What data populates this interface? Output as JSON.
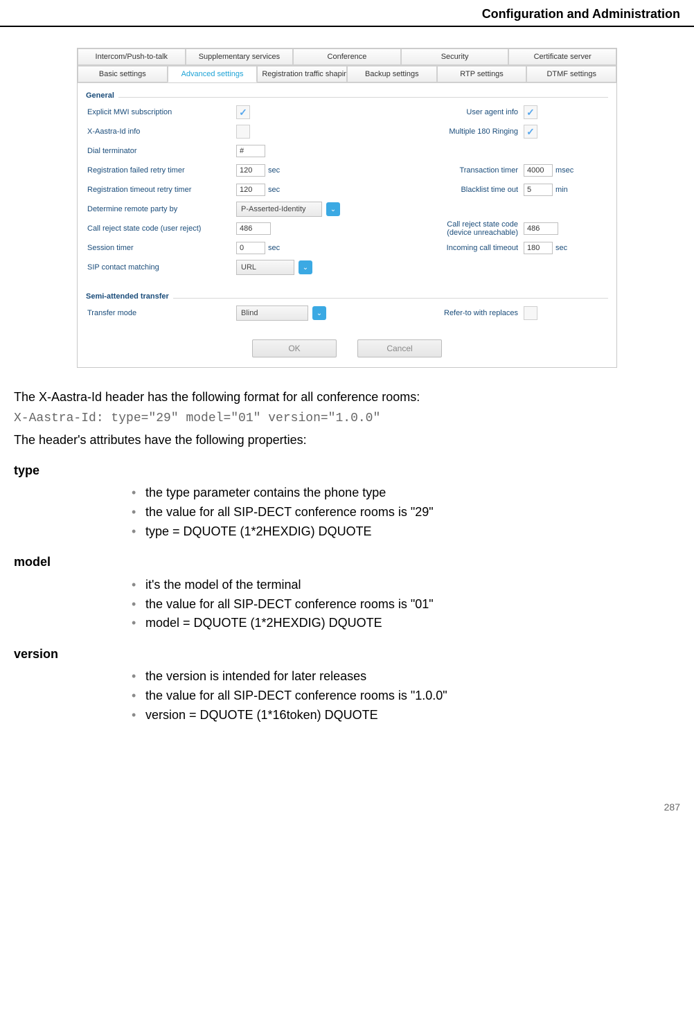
{
  "header": {
    "title": "Configuration and Administration"
  },
  "tabs_row1": [
    {
      "label": "Intercom/Push-to-talk"
    },
    {
      "label": "Supplementary services"
    },
    {
      "label": "Conference"
    },
    {
      "label": "Security"
    },
    {
      "label": "Certificate server"
    }
  ],
  "tabs_row2": [
    {
      "label": "Basic settings"
    },
    {
      "label": "Advanced settings",
      "active": true
    },
    {
      "label": "Registration traffic shaping"
    },
    {
      "label": "Backup settings"
    },
    {
      "label": "RTP settings"
    },
    {
      "label": "DTMF settings"
    }
  ],
  "section_general": "General",
  "section_transfer": "Semi-attended transfer",
  "labels": {
    "explicit_mwi": "Explicit MWI subscription",
    "user_agent": "User agent info",
    "x_aastra": "X-Aastra-Id info",
    "multi_180": "Multiple 180 Ringing",
    "dial_term": "Dial terminator",
    "reg_failed": "Registration failed retry timer",
    "trans_timer": "Transaction timer",
    "reg_timeout": "Registration timeout retry timer",
    "blacklist": "Blacklist time out",
    "determine": "Determine remote party by",
    "call_reject_user": "Call reject state code (user reject)",
    "call_reject_dev1": "Call reject state code",
    "call_reject_dev2": "(device unreachable)",
    "session_timer": "Session timer",
    "incoming_timeout": "Incoming call timeout",
    "sip_contact": "SIP contact matching",
    "transfer_mode": "Transfer mode",
    "refer_to": "Refer-to with replaces"
  },
  "values": {
    "dial_term": "#",
    "reg_failed": "120",
    "reg_timeout": "120",
    "trans_timer": "4000",
    "blacklist": "5",
    "determine": "P-Asserted-Identity",
    "reject_user": "486",
    "reject_dev": "486",
    "session_timer": "0",
    "incoming_timeout": "180",
    "sip_contact": "URL",
    "transfer_mode": "Blind"
  },
  "units": {
    "sec": "sec",
    "msec": "msec",
    "min": "min"
  },
  "buttons": {
    "ok": "OK",
    "cancel": "Cancel"
  },
  "check": "✓",
  "doc": {
    "p1": "The X-Aastra-Id header has the following format for all conference rooms:",
    "code": "X-Aastra-Id: type=\"29\" model=\"01\" version=\"1.0.0\"",
    "p2": "The header's attributes have the following properties:",
    "type_head": "type",
    "type_items": [
      "the type parameter contains the phone type",
      "the value for all SIP-DECT conference rooms is \"29\"",
      "type = DQUOTE (1*2HEXDIG) DQUOTE"
    ],
    "model_head": "model",
    "model_items": [
      "it's the model of the terminal",
      "the value for all SIP-DECT conference rooms is \"01\"",
      "model = DQUOTE (1*2HEXDIG) DQUOTE"
    ],
    "version_head": "version",
    "version_items": [
      "the version is intended for later releases",
      "the value for all SIP-DECT conference rooms is \"1.0.0\"",
      "version = DQUOTE (1*16token) DQUOTE"
    ]
  },
  "page_number": "287"
}
